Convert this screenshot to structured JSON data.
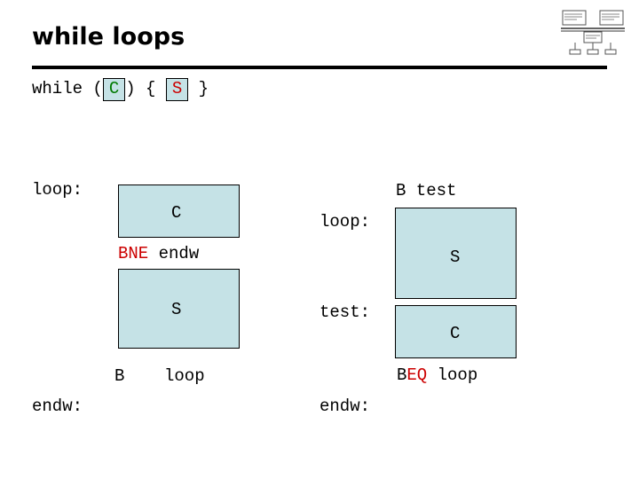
{
  "slide": {
    "title": "while loops",
    "code": {
      "kw": "while ",
      "paren_open": "(",
      "cond": "C",
      "paren_close": ")",
      "brace_open": " { ",
      "stmt": "S",
      "brace_close": " }"
    },
    "left_diagram": {
      "loop_label": "loop:",
      "cond_box_label": "C",
      "branch_ne_prefix": "B",
      "branch_ne_cond": "NE",
      "branch_ne_target": " endw",
      "stmt_box_label": "S",
      "jump_op": "B",
      "jump_target": "loop",
      "endw_label": "endw:"
    },
    "right_diagram": {
      "b_test": "B test",
      "loop_label": "loop:",
      "stmt_box_label": "S",
      "test_label": "test:",
      "cond_box_label": "C",
      "branch_eq_prefix": "B",
      "branch_eq_cond": "EQ",
      "branch_eq_target": " loop",
      "endw_label": "endw:"
    },
    "colors": {
      "box_fill": "#c5e2e6",
      "cond_green": "#007a00",
      "cond_red": "#cc0000",
      "rule": "#000000"
    }
  }
}
